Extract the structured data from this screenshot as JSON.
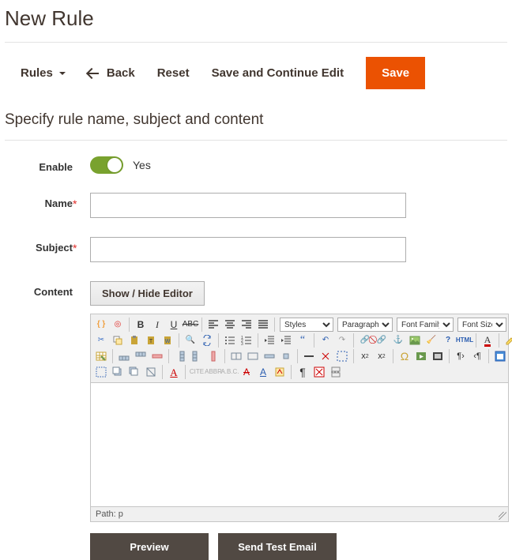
{
  "page_title": "New Rule",
  "toolbar": {
    "rules_label": "Rules",
    "back_label": "Back",
    "reset_label": "Reset",
    "sace_label": "Save and Continue Edit",
    "save_label": "Save"
  },
  "section_heading": "Specify rule name, subject and content",
  "fields": {
    "enable_label": "Enable",
    "enable_value_text": "Yes",
    "enable_value": true,
    "name_label": "Name",
    "name_value": "",
    "subject_label": "Subject",
    "subject_value": "",
    "content_label": "Content",
    "showhide_label": "Show / Hide Editor"
  },
  "editor": {
    "styles_label": "Styles",
    "paragraph_label": "Paragraph",
    "fontfamily_label": "Font Family",
    "fontsize_label": "Font Size",
    "path_label": "Path: p",
    "html_badge": "HTML"
  },
  "buttons": {
    "preview": "Preview",
    "sendtest": "Send Test Email"
  },
  "colors": {
    "primary": "#eb5202",
    "success": "#79a22e",
    "dark": "#514943"
  }
}
